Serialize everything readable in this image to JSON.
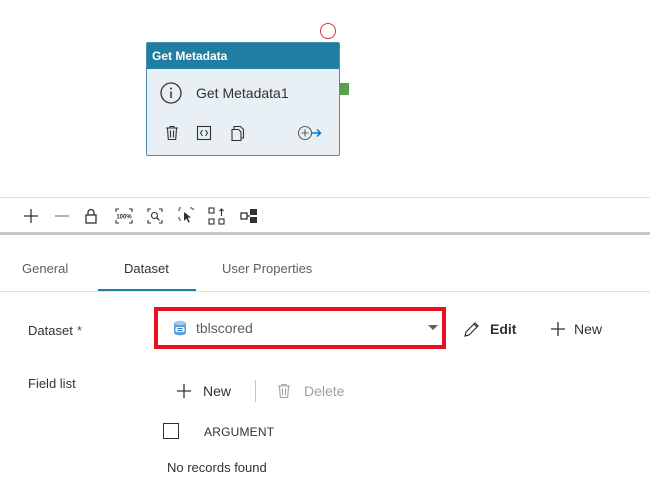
{
  "canvas": {
    "activity": {
      "type_label": "Get Metadata",
      "name": "Get Metadata1"
    },
    "icons": {
      "info": "info-icon",
      "delete": "trash-icon",
      "code": "code-icon",
      "copy": "copy-icon",
      "add_output": "add-output-arrow-icon",
      "status": "status-circle-icon"
    }
  },
  "toolbar": {
    "items": [
      "zoom-in-icon",
      "zoom-out-icon",
      "lock-icon",
      "zoom-100-icon",
      "zoom-to-fit-icon",
      "select-icon",
      "auto-align-icon",
      "layout-icon"
    ],
    "zoom_100_label": "100%"
  },
  "tabs": [
    {
      "label": "General",
      "active": false
    },
    {
      "label": "Dataset",
      "active": true
    },
    {
      "label": "User Properties",
      "active": false
    }
  ],
  "form": {
    "dataset_label": "Dataset",
    "required_mark": "*",
    "dataset_value": "tblscored",
    "edit_label": "Edit",
    "new_label": "New",
    "field_list_label": "Field list",
    "field_new_label": "New",
    "field_delete_label": "Delete",
    "column_header": "ARGUMENT",
    "empty_text": "No records found"
  },
  "colors": {
    "accent": "#1f7ea1",
    "highlight_box": "#e81123",
    "required": "#a4262c",
    "port": "#57a14a",
    "status_ring": "#d13438"
  }
}
